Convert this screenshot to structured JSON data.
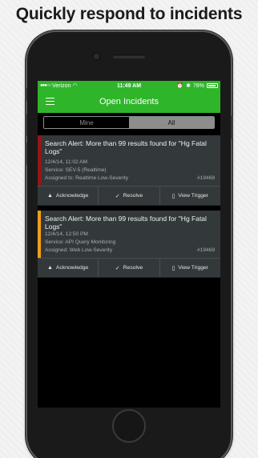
{
  "headline": "Quickly respond to incidents",
  "status_bar": {
    "carrier": "Verizon",
    "time": "11:49 AM",
    "battery": "78%"
  },
  "nav": {
    "title": "Open Incidents"
  },
  "segments": {
    "mine": "Mine",
    "all": "All",
    "selected": "All"
  },
  "incidents": [
    {
      "title": "Search Alert: More than 99 results found for \"Hg Fatal Logs\"",
      "timestamp": "12/4/14, 11:02 AM",
      "service": "Service: SEV-5 (Realtime)",
      "assigned": "Assigned to: Realtime Low-Severity",
      "number": "#19468",
      "severity_color": "#9b1414"
    },
    {
      "title": "Search Alert: More than 99 results found for \"Hg Fatal Logs\"",
      "timestamp": "12/4/14, 12:50 PM",
      "service": "Service: API Query Monitoring",
      "assigned": "Assigned: Web Low-Severity",
      "number": "#19469",
      "severity_color": "#f0a018"
    }
  ],
  "actions": {
    "acknowledge": "Acknowledge",
    "resolve": "Resolve",
    "view_trigger": "View Trigger"
  },
  "icons": {
    "acknowledge": "warning-triangle-icon",
    "resolve": "checkmark-icon",
    "view_trigger": "document-icon"
  },
  "colors": {
    "brand_green": "#2fb52a"
  }
}
